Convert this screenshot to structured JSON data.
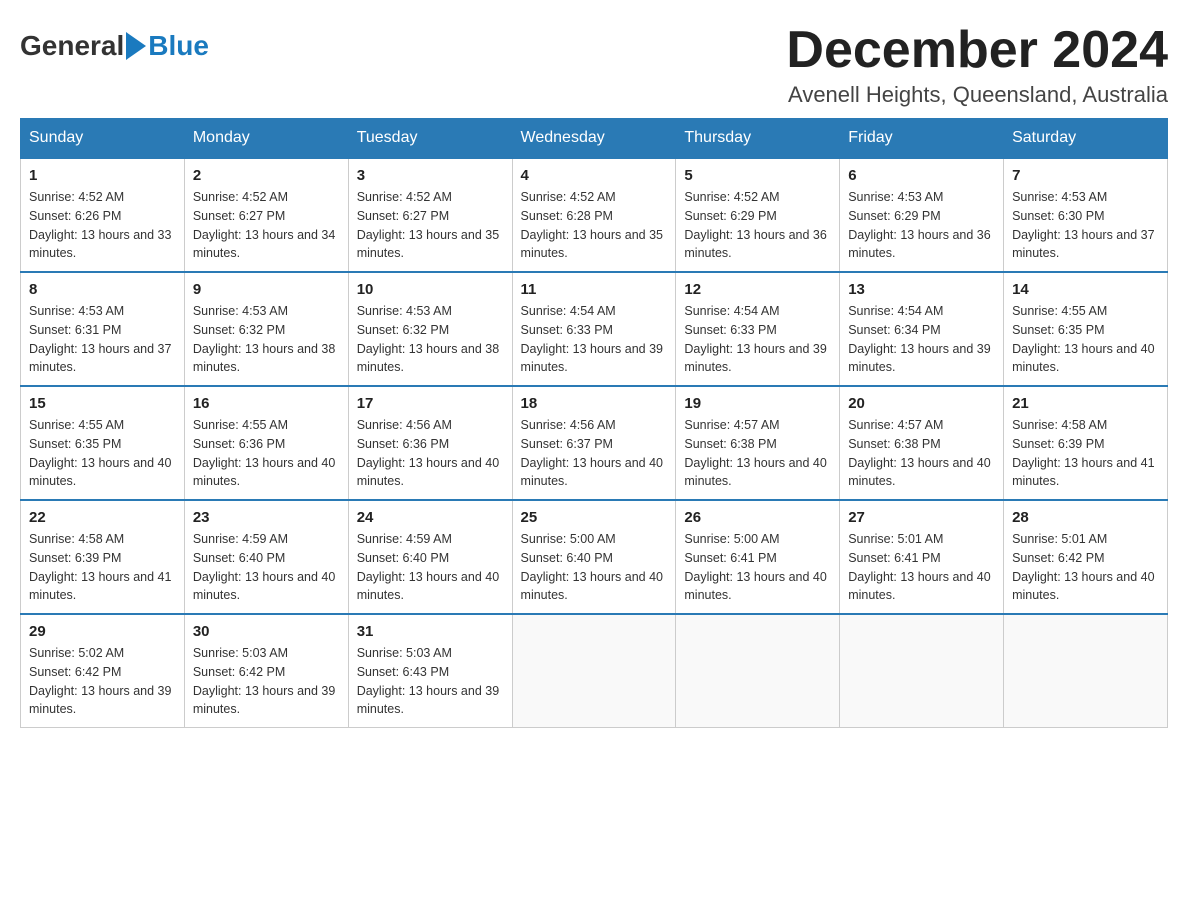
{
  "header": {
    "logo_general": "General",
    "logo_blue": "Blue",
    "month_year": "December 2024",
    "location": "Avenell Heights, Queensland, Australia"
  },
  "weekdays": [
    "Sunday",
    "Monday",
    "Tuesday",
    "Wednesday",
    "Thursday",
    "Friday",
    "Saturday"
  ],
  "weeks": [
    [
      {
        "day": "1",
        "sunrise": "4:52 AM",
        "sunset": "6:26 PM",
        "daylight": "13 hours and 33 minutes."
      },
      {
        "day": "2",
        "sunrise": "4:52 AM",
        "sunset": "6:27 PM",
        "daylight": "13 hours and 34 minutes."
      },
      {
        "day": "3",
        "sunrise": "4:52 AM",
        "sunset": "6:27 PM",
        "daylight": "13 hours and 35 minutes."
      },
      {
        "day": "4",
        "sunrise": "4:52 AM",
        "sunset": "6:28 PM",
        "daylight": "13 hours and 35 minutes."
      },
      {
        "day": "5",
        "sunrise": "4:52 AM",
        "sunset": "6:29 PM",
        "daylight": "13 hours and 36 minutes."
      },
      {
        "day": "6",
        "sunrise": "4:53 AM",
        "sunset": "6:29 PM",
        "daylight": "13 hours and 36 minutes."
      },
      {
        "day": "7",
        "sunrise": "4:53 AM",
        "sunset": "6:30 PM",
        "daylight": "13 hours and 37 minutes."
      }
    ],
    [
      {
        "day": "8",
        "sunrise": "4:53 AM",
        "sunset": "6:31 PM",
        "daylight": "13 hours and 37 minutes."
      },
      {
        "day": "9",
        "sunrise": "4:53 AM",
        "sunset": "6:32 PM",
        "daylight": "13 hours and 38 minutes."
      },
      {
        "day": "10",
        "sunrise": "4:53 AM",
        "sunset": "6:32 PM",
        "daylight": "13 hours and 38 minutes."
      },
      {
        "day": "11",
        "sunrise": "4:54 AM",
        "sunset": "6:33 PM",
        "daylight": "13 hours and 39 minutes."
      },
      {
        "day": "12",
        "sunrise": "4:54 AM",
        "sunset": "6:33 PM",
        "daylight": "13 hours and 39 minutes."
      },
      {
        "day": "13",
        "sunrise": "4:54 AM",
        "sunset": "6:34 PM",
        "daylight": "13 hours and 39 minutes."
      },
      {
        "day": "14",
        "sunrise": "4:55 AM",
        "sunset": "6:35 PM",
        "daylight": "13 hours and 40 minutes."
      }
    ],
    [
      {
        "day": "15",
        "sunrise": "4:55 AM",
        "sunset": "6:35 PM",
        "daylight": "13 hours and 40 minutes."
      },
      {
        "day": "16",
        "sunrise": "4:55 AM",
        "sunset": "6:36 PM",
        "daylight": "13 hours and 40 minutes."
      },
      {
        "day": "17",
        "sunrise": "4:56 AM",
        "sunset": "6:36 PM",
        "daylight": "13 hours and 40 minutes."
      },
      {
        "day": "18",
        "sunrise": "4:56 AM",
        "sunset": "6:37 PM",
        "daylight": "13 hours and 40 minutes."
      },
      {
        "day": "19",
        "sunrise": "4:57 AM",
        "sunset": "6:38 PM",
        "daylight": "13 hours and 40 minutes."
      },
      {
        "day": "20",
        "sunrise": "4:57 AM",
        "sunset": "6:38 PM",
        "daylight": "13 hours and 40 minutes."
      },
      {
        "day": "21",
        "sunrise": "4:58 AM",
        "sunset": "6:39 PM",
        "daylight": "13 hours and 41 minutes."
      }
    ],
    [
      {
        "day": "22",
        "sunrise": "4:58 AM",
        "sunset": "6:39 PM",
        "daylight": "13 hours and 41 minutes."
      },
      {
        "day": "23",
        "sunrise": "4:59 AM",
        "sunset": "6:40 PM",
        "daylight": "13 hours and 40 minutes."
      },
      {
        "day": "24",
        "sunrise": "4:59 AM",
        "sunset": "6:40 PM",
        "daylight": "13 hours and 40 minutes."
      },
      {
        "day": "25",
        "sunrise": "5:00 AM",
        "sunset": "6:40 PM",
        "daylight": "13 hours and 40 minutes."
      },
      {
        "day": "26",
        "sunrise": "5:00 AM",
        "sunset": "6:41 PM",
        "daylight": "13 hours and 40 minutes."
      },
      {
        "day": "27",
        "sunrise": "5:01 AM",
        "sunset": "6:41 PM",
        "daylight": "13 hours and 40 minutes."
      },
      {
        "day": "28",
        "sunrise": "5:01 AM",
        "sunset": "6:42 PM",
        "daylight": "13 hours and 40 minutes."
      }
    ],
    [
      {
        "day": "29",
        "sunrise": "5:02 AM",
        "sunset": "6:42 PM",
        "daylight": "13 hours and 39 minutes."
      },
      {
        "day": "30",
        "sunrise": "5:03 AM",
        "sunset": "6:42 PM",
        "daylight": "13 hours and 39 minutes."
      },
      {
        "day": "31",
        "sunrise": "5:03 AM",
        "sunset": "6:43 PM",
        "daylight": "13 hours and 39 minutes."
      },
      null,
      null,
      null,
      null
    ]
  ]
}
